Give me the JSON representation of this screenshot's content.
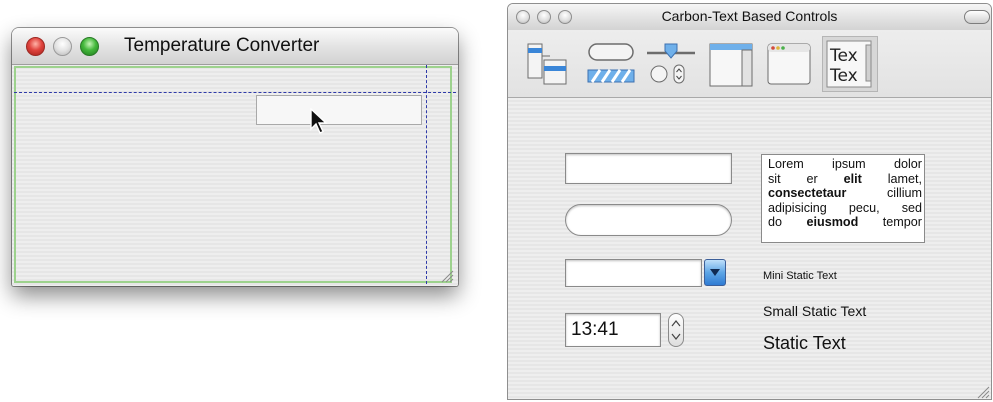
{
  "window1": {
    "title": "Temperature Converter"
  },
  "window2": {
    "title": "Carbon-Text Based Controls",
    "toolbar": {
      "items": [
        {
          "icon": "layout-icon"
        },
        {
          "icon": "buttons-icon"
        },
        {
          "icon": "value-controls-icon"
        },
        {
          "icon": "views-icon"
        },
        {
          "icon": "windows-icon"
        },
        {
          "icon": "text-controls-icon",
          "selected": true,
          "glyph": "Tex"
        }
      ]
    },
    "text_view": {
      "lines": [
        [
          {
            "t": "Lorem ipsum dolor"
          }
        ],
        [
          {
            "t": "sit er "
          },
          {
            "t": "elit",
            "b": true
          },
          {
            "t": " lamet,"
          }
        ],
        [
          {
            "t": "consectetaur",
            "b": true
          },
          {
            "t": " cillium"
          }
        ],
        [
          {
            "t": "adipisicing pecu, sed"
          }
        ],
        [
          {
            "t": "do "
          },
          {
            "t": "eiusmod",
            "b": true
          },
          {
            "t": " tempor"
          }
        ]
      ]
    },
    "time_field": {
      "value": "13:41"
    },
    "static_texts": {
      "mini": "Mini Static Text",
      "small": "Small Static Text",
      "regular": "Static Text"
    }
  },
  "colors": {
    "guide": "#2f3aa8",
    "selection_edge": "#9dd28d",
    "close": "#e0443e",
    "zoom": "#38b23a",
    "accent": "#3a86d8"
  }
}
